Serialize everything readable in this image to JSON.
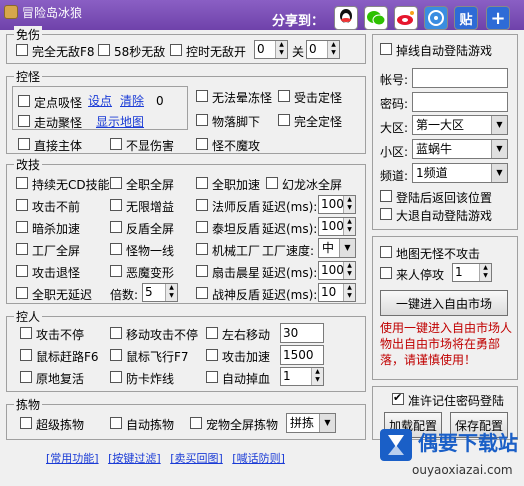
{
  "window": {
    "title": "冒险岛冰狼",
    "share_label": "分享到："
  },
  "share": [
    "qq-icon",
    "wechat-icon",
    "weibo-icon",
    "pengyou-icon",
    "tie-icon",
    "plus-icon"
  ],
  "share_text": {
    "tie": "贴",
    "plus": "+"
  },
  "invincible": {
    "title": "免伤",
    "full_invincible": "完全无敌F8",
    "sec58": "58秒无敌",
    "control_time": "控时无敌开",
    "off": "关",
    "on_value": "0",
    "off_value": "0"
  },
  "monster": {
    "title": "控怪",
    "fixed_suck": "定点吸怪",
    "set_point": "设点",
    "clear": "清除",
    "count": "0",
    "walk_gather": "走动聚怪",
    "show_map": "显示地图",
    "no_freeze": "无法晕冻怪",
    "hit_fixed": "受击定怪",
    "item_foot": "物落脚下",
    "full_fixed": "完全定怪",
    "attack_body": "直接主体",
    "no_damage": "不显伤害",
    "no_magic": "怪不魔攻"
  },
  "skills": {
    "title": "改技",
    "items": {
      "hold_no_cd": "持续无CD技能",
      "all_job_screen": "全职全屏",
      "all_job_speed": "全职加速",
      "illusion_screen": "幻龙冰全屏",
      "attack_no_move": "攻击不前",
      "infinite_gain": "无限增益",
      "mage_shield": "法师反盾",
      "shadow_speed": "暗杀加速",
      "reflect_screen": "反盾全屏",
      "titan_shield": "泰坦反盾",
      "factory_screen": "工厂全屏",
      "monster_line": "怪物一线",
      "machine_factory": "机械工厂",
      "attack_retreat": "攻击退怪",
      "demon_transform": "恶魔变形",
      "sector_morning": "扇击晨星",
      "all_job_no_delay": "全职无延迟",
      "war_god_shield": "战神反盾"
    },
    "delay_label": "延迟(ms):",
    "factory_speed_label": "工厂速度:",
    "multiplier_label": "倍数:",
    "values": {
      "mage": "100",
      "titan": "100",
      "sector": "100",
      "war_god": "10",
      "multiplier": "5",
      "factory_speed": "中"
    }
  },
  "control_person": {
    "title": "控人",
    "attack_nonstop": "攻击不停",
    "move_attack_nonstop": "移动攻击不停",
    "left_right_move": "左右移动",
    "mouse_jump": "鼠标赶路F6",
    "mouse_fly": "鼠标飞行F7",
    "attack_speed": "攻击加速",
    "revive_in_place": "原地复活",
    "anti_card_bomb": "防卡炸线",
    "auto_drop_line": "自动掉血",
    "values": {
      "left_right": "30",
      "attack_speed": "1500",
      "auto_drop": "1"
    }
  },
  "pickup": {
    "title": "拣物",
    "super_pickup": "超级拣物",
    "auto_pickup": "自动拣物",
    "pet_full_screen": "宠物全屏拣物",
    "pickup_mode": "拼拣"
  },
  "right_panel": {
    "auto_relogin": "掉线自动登陆游戏",
    "account_label": "帐号:",
    "password_label": "密码:",
    "region_label": "大区:",
    "region_value": "第一大区",
    "subregion_label": "小区:",
    "subregion_value": "蓝蜗牛",
    "channel_label": "频道:",
    "channel_value": "1频道",
    "return_after_login": "登陆后返回该位置",
    "auto_login_big": "大退自动登陆游戏",
    "map_no_attack": "地图无怪不攻击",
    "stop_on_people": "来人停攻",
    "stop_value": "1",
    "enter_market": "一键进入自由市场",
    "market_tip": "使用一键进入自由市场人物出自由市场将在勇部落，请谨慎使用！",
    "remember_password": "准许记住密码登陆",
    "load_config": "加载配置",
    "save_config": "保存配置"
  },
  "bottom_links": [
    "[常用功能]",
    "[按键过滤]",
    "[卖买回图]",
    "[喊话防则]"
  ],
  "watermark": {
    "brand": "偶要下载站",
    "url": "ouyaoxiazai.com"
  }
}
